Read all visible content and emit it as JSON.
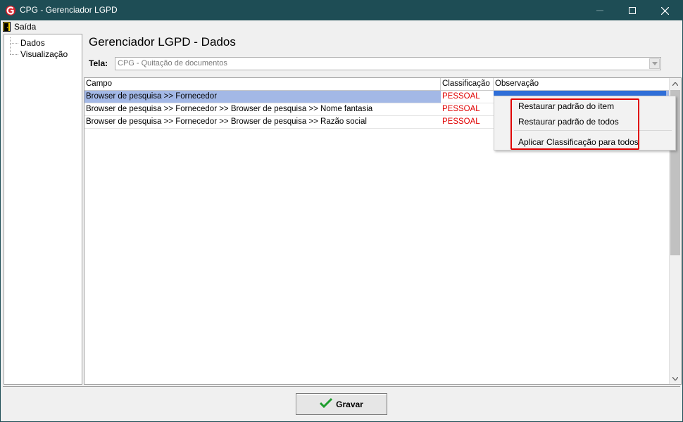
{
  "window": {
    "title": "CPG - Gerenciador LGPD"
  },
  "menu": {
    "exit_label": "Saída"
  },
  "tree": {
    "items": [
      "Dados",
      "Visualização"
    ]
  },
  "page": {
    "title": "Gerenciador LGPD - Dados"
  },
  "tela": {
    "label": "Tela:",
    "value": "CPG - Quitação de documentos"
  },
  "grid": {
    "columns": [
      "Campo",
      "Classificação",
      "Observação"
    ],
    "rows": [
      {
        "campo": "Browser de pesquisa >> Fornecedor",
        "classificacao": "PESSOAL",
        "observacao": ""
      },
      {
        "campo": "Browser de pesquisa >> Fornecedor >> Browser de pesquisa >>  Nome fantasia",
        "classificacao": "PESSOAL",
        "observacao": ""
      },
      {
        "campo": "Browser de pesquisa >> Fornecedor >> Browser de pesquisa >>  Razão social",
        "classificacao": "PESSOAL",
        "observacao": ""
      }
    ]
  },
  "context_menu": {
    "items": [
      "Restaurar padrão do item",
      "Restaurar padrão de todos",
      "Aplicar Classificação para todos"
    ]
  },
  "footer": {
    "save_label": "Gravar"
  },
  "colors": {
    "titlebar": "#1e4d55",
    "selection": "#a3b8e6",
    "classification_text": "#e00000",
    "highlight_box": "#e00000"
  }
}
